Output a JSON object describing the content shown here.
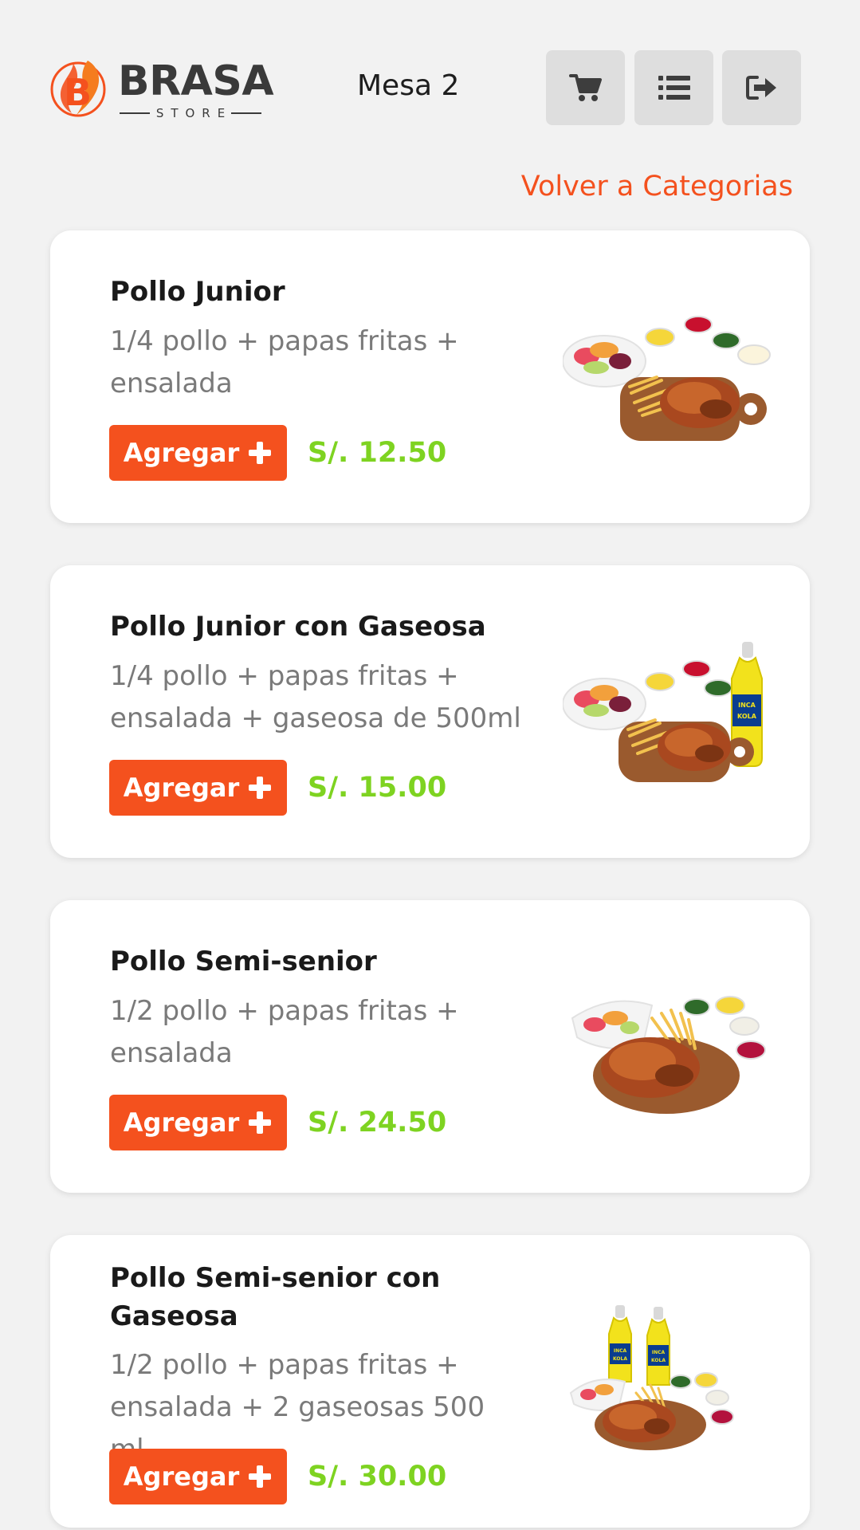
{
  "brand": {
    "name": "BRASA",
    "sub": "STORE",
    "mark_letter": "B"
  },
  "header": {
    "table_label": "Mesa 2",
    "buttons": [
      {
        "icon": "cart-icon"
      },
      {
        "icon": "list-icon"
      },
      {
        "icon": "logout-icon"
      }
    ]
  },
  "back_link": "Volver a Categorias",
  "colors": {
    "accent": "#f4511e",
    "price": "#7ed321",
    "background": "#f2f2f2",
    "header_button": "#dedede"
  },
  "products": [
    {
      "name": "Pollo Junior",
      "description": "1/4 pollo + papas fritas + ensalada",
      "button": "Agregar",
      "price": "S/. 12.50",
      "image": "chicken-quarter-plate"
    },
    {
      "name": "Pollo Junior con Gaseosa",
      "description": "1/4 pollo + papas fritas + ensalada + gaseosa de 500ml",
      "button": "Agregar",
      "price": "S/. 15.00",
      "image": "chicken-quarter-plate-with-soda",
      "soda_label": "INCA KOLA"
    },
    {
      "name": "Pollo Semi-senior",
      "description": "1/2 pollo + papas fritas + ensalada",
      "button": "Agregar",
      "price": "S/. 24.50",
      "image": "chicken-half-plate"
    },
    {
      "name": "Pollo Semi-senior con Gaseosa",
      "description": "1/2 pollo + papas fritas + ensalada + 2 gaseosas 500 ml",
      "button": "Agregar",
      "price": "S/. 30.00",
      "image": "chicken-half-plate-with-two-sodas",
      "soda_label": "INCA KOLA"
    }
  ]
}
